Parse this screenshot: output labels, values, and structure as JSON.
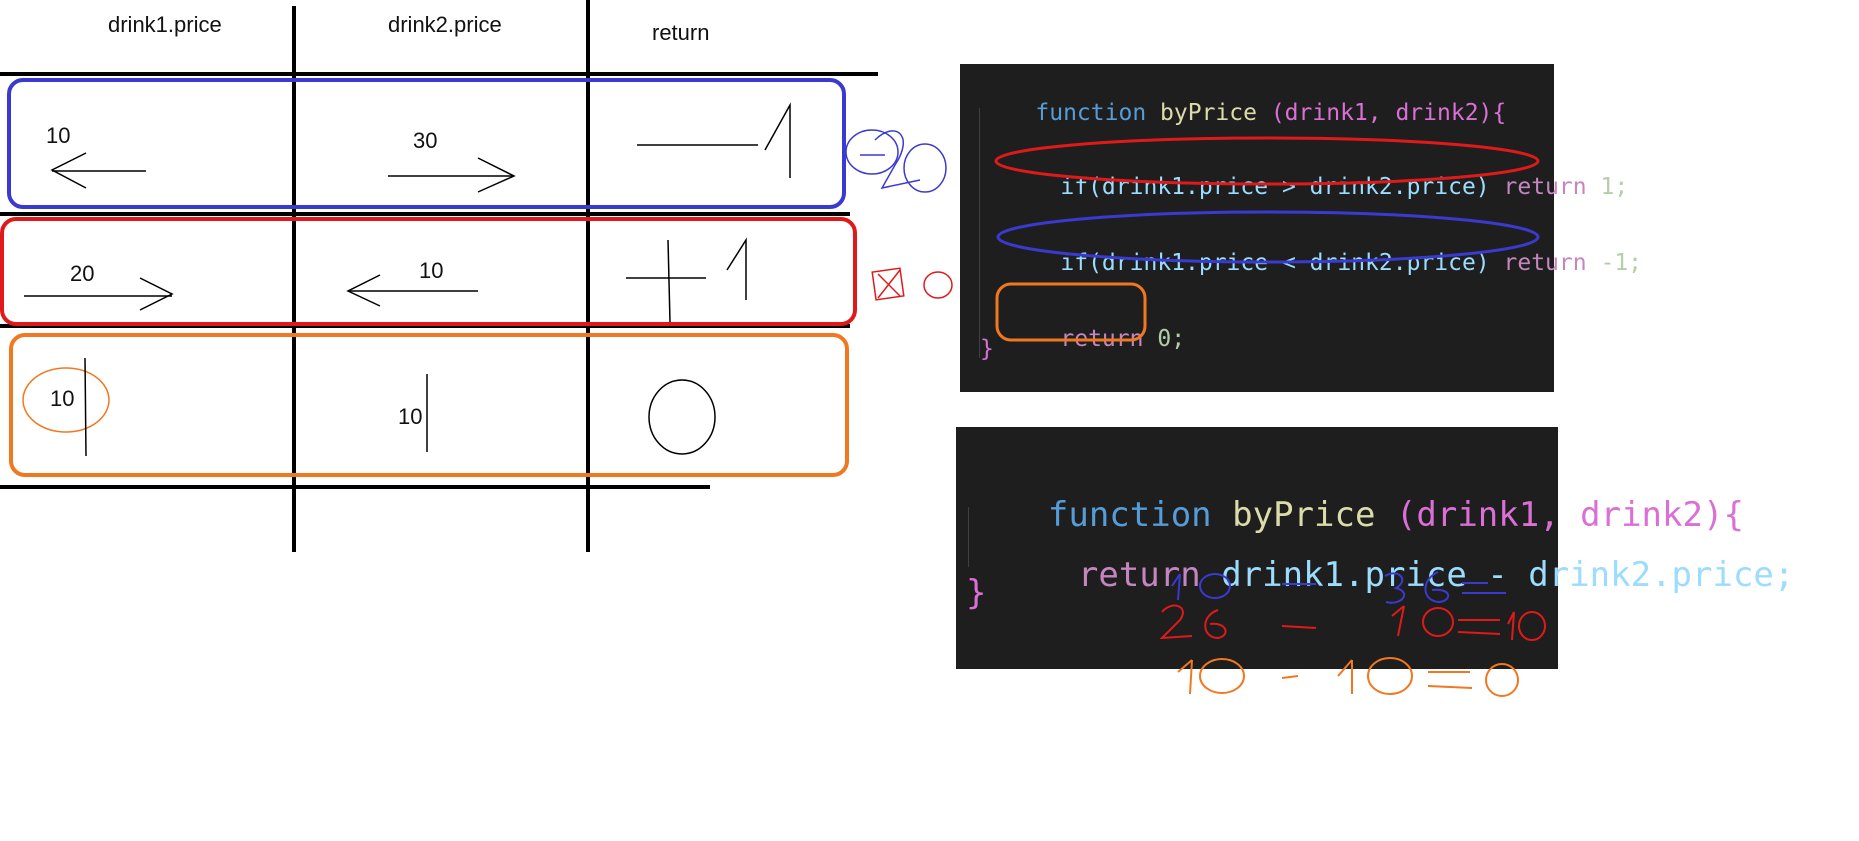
{
  "table": {
    "headers": [
      "drink1.price",
      "drink2.price",
      "return"
    ],
    "rows": [
      {
        "drink1": "10",
        "drink2": "30",
        "color": "#3a3ad0"
      },
      {
        "drink1": "20",
        "drink2": "10",
        "color": "#e01a1a"
      },
      {
        "drink1": "10",
        "drink2": "10",
        "color": "#f07820"
      }
    ]
  },
  "code_top": {
    "line1": {
      "kw": "function",
      "name": "byPrice",
      "params": "(drink1, drink2){"
    },
    "line2": {
      "if": "if(drink1.price > drink2.price)",
      "ret": "return",
      "val": "1;"
    },
    "line3": {
      "if": "if(drink1.price < drink2.price)",
      "ret": "return",
      "val": "-1;"
    },
    "line4": {
      "ret": "return",
      "val": "0;"
    },
    "close": "}"
  },
  "code_bottom": {
    "line1": {
      "kw": "function",
      "name": "byPrice",
      "params": "(drink1, drink2){"
    },
    "line2": {
      "ret": "return",
      "expr": "drink1.price - drink2.price;"
    },
    "close": "}"
  },
  "colors": {
    "blue": "#3a3ad0",
    "red": "#e01a1a",
    "orange": "#f07820",
    "panel_bg": "#1e1e1e"
  }
}
